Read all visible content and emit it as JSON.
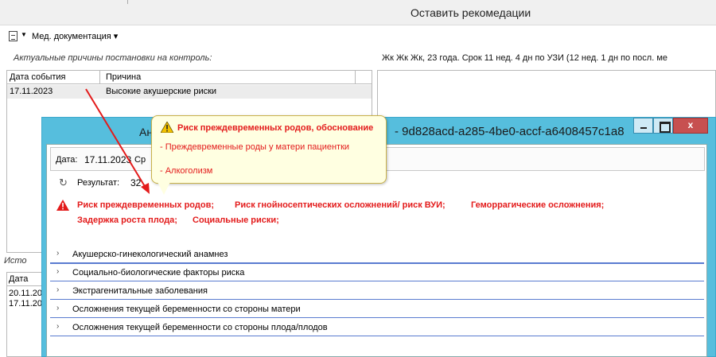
{
  "main": {
    "title": "Оставить рекомедации",
    "toolbar": {
      "menu_label": "Мед. документация ▾"
    },
    "reasons_label": "Актуальные причины постановки на контроль:",
    "patient_info": "Жк Жк Жк, 23 года. Срок 11 нед. 4 дн по УЗИ (12 нед. 1 дн по посл. ме",
    "reasons_table": {
      "columns": [
        "Дата события",
        "Причина"
      ],
      "rows": [
        {
          "date": "17.11.2023",
          "reason": "Высокие акушерские риски"
        }
      ]
    },
    "history": {
      "label": "Исто",
      "column": "Дата",
      "rows": [
        "20.11.20",
        "17.11.20"
      ]
    }
  },
  "modal": {
    "title_left": "Ан",
    "title_right": "- 9d828acd-a285-4be0-accf-a6408457c1a8",
    "close_label": "x",
    "date_label": "Дата:",
    "date_value": "17.11.2023",
    "srok_label": "Ср",
    "result_label": "Результат:",
    "result_value": "32",
    "risks": [
      "Риск преждевременных родов;",
      "Риск гнойносептических осложнений/ риск ВУИ;",
      "Геморрагические осложнения;",
      "Задержка роста плода;",
      "Социальные риски;"
    ],
    "sections": [
      "Акушерско-гинекологический анамнез",
      "Социально-биологические факторы риска",
      "Экстрагенитальные заболевания",
      "Осложнения текущей беременности со стороны матери",
      "Осложнения текущей беременности со стороны плода/плодов"
    ]
  },
  "tooltip": {
    "title": "Риск преждевременных родов, обоснование",
    "lines": [
      "- Преждевременные роды у матери пациентки",
      "- Алкоголизм"
    ]
  },
  "colors": {
    "risk_red": "#e31b1b",
    "modal_border": "#56bedd",
    "tooltip_bg": "#ffffe1"
  },
  "icons": {
    "toolbar": "document-icon",
    "refresh": "refresh-icon",
    "warning": "warning-triangle-icon"
  }
}
